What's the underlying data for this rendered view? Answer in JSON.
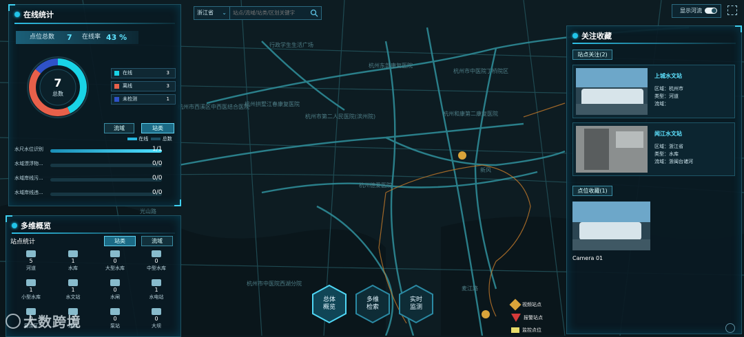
{
  "search": {
    "province": "浙江省",
    "placeholder": "站点/流域/站类/区划关键字"
  },
  "toggle": {
    "label": "显示河流"
  },
  "map_labels": [
    "行政学生生活广场",
    "杭州市西溪区中西医结合医院",
    "杭州拱墅江春康复医院",
    "杭州东部康复医院",
    "杭州市第二人民医院(滨州院)",
    "杭州市中医院丁桥院区",
    "杭州和康第二康复医院",
    "新风",
    "杭州德爱医院",
    "杭州市中医院西湖分院",
    "麦江路",
    "光山路"
  ],
  "online": {
    "title": "在线统计",
    "total_label": "点位总数",
    "total_value": "7",
    "rate_label": "在线率",
    "rate_value": "43 %",
    "donut_value": "7",
    "donut_label": "总数",
    "legend": [
      {
        "label": "在线",
        "value": "3",
        "color": "#19d3e6"
      },
      {
        "label": "离线",
        "value": "3",
        "color": "#e8604a"
      },
      {
        "label": "未检测",
        "value": "1",
        "color": "#2f52c8"
      }
    ],
    "tabs": [
      "流域",
      "站类"
    ],
    "mini_legend": [
      "在线",
      "总数"
    ],
    "bars": [
      {
        "label": "水尺水位识别",
        "value": "1/1",
        "ratio": 1
      },
      {
        "label": "水域漂浮物...",
        "value": "0/0",
        "ratio": 0
      },
      {
        "label": "水域岸线污...",
        "value": "0/0",
        "ratio": 0
      },
      {
        "label": "水域岸线违...",
        "value": "0/0",
        "ratio": 0
      }
    ]
  },
  "multi": {
    "title": "多维概览",
    "sub": "站点统计",
    "tabs": [
      "站类",
      "流域"
    ],
    "stats": [
      {
        "n": "5",
        "label": "河道"
      },
      {
        "n": "1",
        "label": "水库"
      },
      {
        "n": "0",
        "label": "大型水库"
      },
      {
        "n": "0",
        "label": "中型水库"
      },
      {
        "n": "1",
        "label": "小型水库"
      },
      {
        "n": "1",
        "label": "水文站"
      },
      {
        "n": "0",
        "label": "水闸"
      },
      {
        "n": "1",
        "label": "水电站"
      },
      {
        "n": "0",
        "label": "易涝区"
      },
      {
        "n": "0",
        "label": "泄洪"
      },
      {
        "n": "0",
        "label": "泵站"
      },
      {
        "n": "0",
        "label": "大坝"
      }
    ]
  },
  "nav": [
    {
      "l1": "总体",
      "l2": "概览"
    },
    {
      "l1": "多维",
      "l2": "检索"
    },
    {
      "l1": "实时",
      "l2": "监测"
    }
  ],
  "markers": [
    "视频站点",
    "报警站点",
    "监控点位"
  ],
  "watermark": "大数跨境",
  "favorites": {
    "title": "关注收藏",
    "station_tab": "站点关注(2)",
    "point_tab": "点位收藏(1)",
    "stations": [
      {
        "name": "上城水文站",
        "area": "区域：杭州市",
        "type": "类型：河道",
        "basin": "流域："
      },
      {
        "name": "闻江水文站",
        "area": "区域：浙江省",
        "type": "类型：水库",
        "basin": "流域：浙闽台诸河"
      }
    ],
    "camera_label": "Camera 01"
  }
}
